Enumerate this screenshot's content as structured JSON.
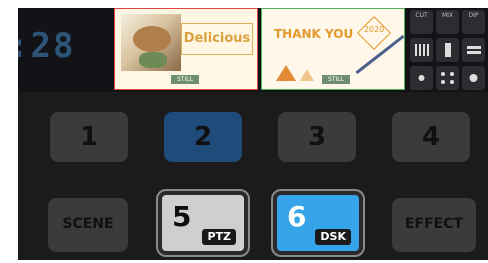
{
  "clock": ":28",
  "monitors": {
    "preview": {
      "heading": "Delicious",
      "tag": "STILL"
    },
    "program": {
      "heading": "THANK YOU",
      "year": "2020",
      "tag": "STILL"
    }
  },
  "transition_keys": [
    "CUT",
    "MIX",
    "DIP"
  ],
  "inputs": [
    "1",
    "2",
    "3",
    "4"
  ],
  "active_input": "2",
  "bottom": {
    "scene": "SCENE",
    "ptz_num": "5",
    "ptz_label": "PTZ",
    "dsk_num": "6",
    "dsk_label": "DSK",
    "effect": "EFFECT"
  },
  "colors": {
    "active_blue": "#1f4b7a",
    "dsk_blue": "#35a4e8",
    "preview_border": "#e64545",
    "program_border": "#52b25a"
  }
}
